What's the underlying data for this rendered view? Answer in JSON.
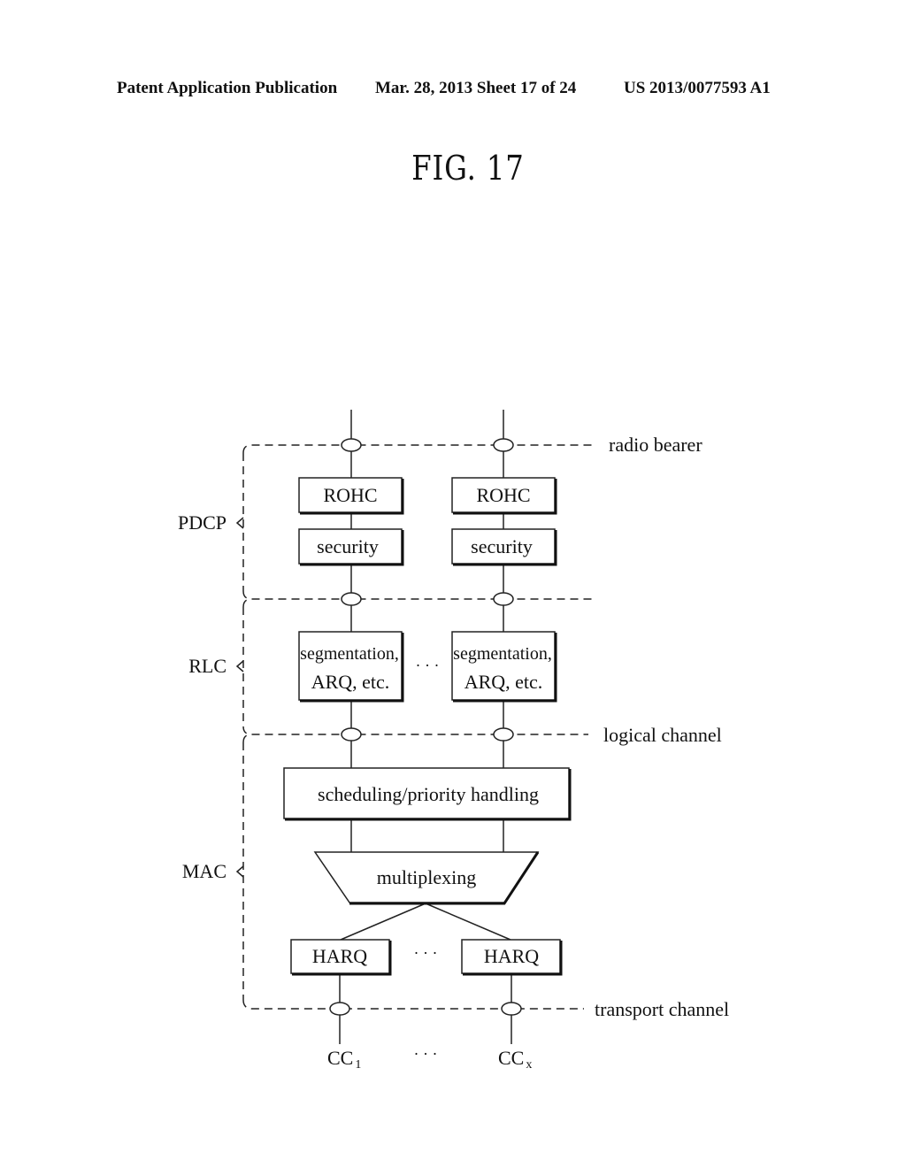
{
  "header": {
    "publication": "Patent Application Publication",
    "date_sheet": "Mar. 28, 2013  Sheet 17 of 24",
    "pub_number": "US 2013/0077593 A1"
  },
  "figure": {
    "title": "FIG. 17",
    "layers": [
      {
        "name": "PDCP"
      },
      {
        "name": "RLC"
      },
      {
        "name": "MAC"
      }
    ],
    "channels": {
      "radio_bearer": "radio bearer",
      "logical_channel": "logical channel",
      "transport_channel": "transport channel"
    },
    "boxes": {
      "rohc_left": "ROHC",
      "rohc_right": "ROHC",
      "security_left": "security",
      "security_right": "security",
      "seg_left_line1": "segmentation,",
      "seg_left_line2": "ARQ, etc.",
      "seg_right_line1": "segmentation,",
      "seg_right_line2": "ARQ, etc.",
      "scheduling": "scheduling/priority handling",
      "multiplexing": "multiplexing",
      "harq_left": "HARQ",
      "harq_right": "HARQ"
    },
    "ellipsis": "· · ·",
    "carriers": {
      "first": "CC",
      "first_sub": "1",
      "last": "CC",
      "last_sub": "x"
    }
  }
}
